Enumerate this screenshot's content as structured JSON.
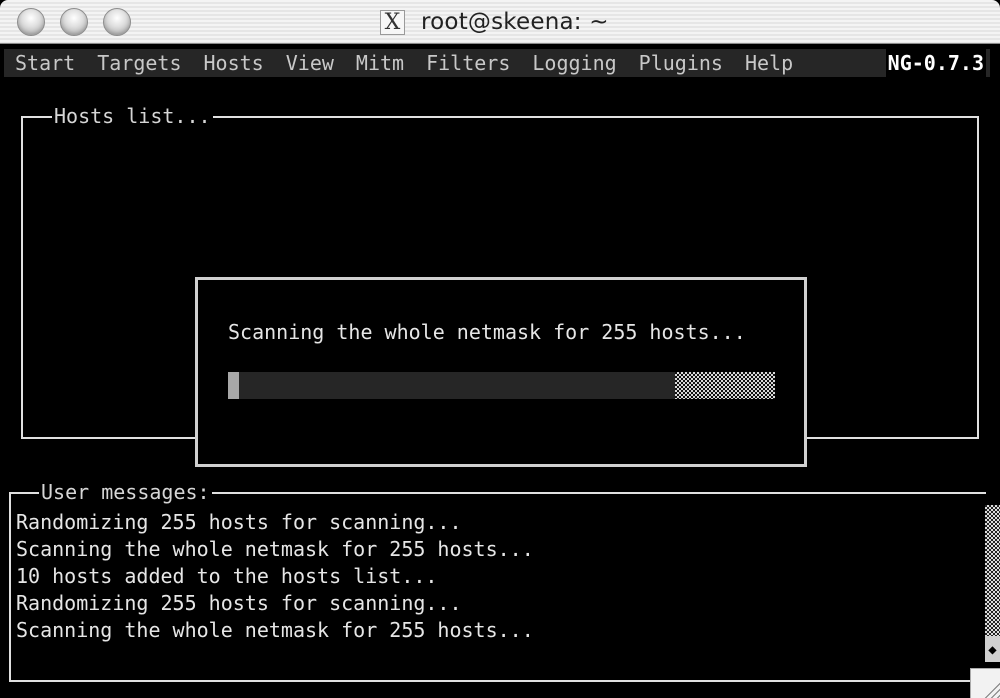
{
  "window": {
    "title": "root@skeena: ~",
    "title_icon": "x11-icon",
    "title_icon_glyph": "X"
  },
  "menubar": {
    "items": [
      "Start",
      "Targets",
      "Hosts",
      "View",
      "Mitm",
      "Filters",
      "Logging",
      "Plugins",
      "Help"
    ],
    "version": "NG-0.7.3"
  },
  "hosts_panel": {
    "title": "Hosts list..."
  },
  "scan_dialog": {
    "message": "Scanning the whole netmask for 255 hosts...",
    "progress_percent": 2
  },
  "messages_panel": {
    "title": "User messages:",
    "lines": [
      "Randomizing 255 hosts for scanning...",
      "Scanning the whole netmask for 255 hosts...",
      "10 hosts added to the hosts list...",
      "Randomizing 255 hosts for scanning...",
      "Scanning the whole netmask for 255 hosts..."
    ]
  },
  "colors": {
    "background": "#000000",
    "menubar_bg": "#262626",
    "menu_text": "#c8c8c8",
    "text": "#e6e6e6",
    "progress_fill": "#a8a8a8",
    "progress_track": "#262626"
  }
}
